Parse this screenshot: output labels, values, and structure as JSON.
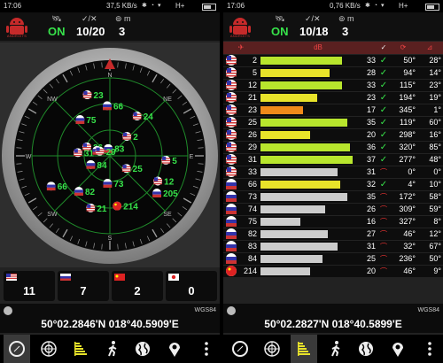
{
  "left": {
    "status": {
      "time": "17:06",
      "speed": "37,5 KB/s",
      "carrier": "H+"
    },
    "header": {
      "logo_text": "ANDROITS",
      "fix": "ON",
      "sats": "10/20",
      "m_value": "3"
    },
    "radar": {
      "compass_labels": [
        "N",
        "NE",
        "E",
        "SE",
        "S",
        "SW",
        "W",
        "NW"
      ],
      "satellites": [
        {
          "prn": "23",
          "flag": "us",
          "az": 345,
          "el": 17
        },
        {
          "prn": "66",
          "flag": "ru",
          "az": 4,
          "el": 32
        },
        {
          "prn": "24",
          "flag": "us",
          "az": 40,
          "el": 30
        },
        {
          "prn": "2",
          "flag": "us",
          "az": 50,
          "el": 55
        },
        {
          "prn": "75",
          "flag": "ru",
          "az": 327,
          "el": 40
        },
        {
          "prn": "26",
          "flag": "us",
          "az": 298,
          "el": 68
        },
        {
          "prn": "74",
          "flag": "ru",
          "az": 309,
          "el": 80
        },
        {
          "prn": "83",
          "flag": "ru",
          "az": 32,
          "el": 80
        },
        {
          "prn": "29",
          "flag": "us",
          "az": 320,
          "el": 83
        },
        {
          "prn": "31",
          "flag": "us",
          "az": 277,
          "el": 60
        },
        {
          "prn": "25",
          "flag": "us",
          "az": 119,
          "el": 60
        },
        {
          "prn": "5",
          "flag": "us",
          "az": 94,
          "el": 18
        },
        {
          "prn": "12",
          "flag": "us",
          "az": 115,
          "el": 21
        },
        {
          "prn": "205",
          "flag": "ru",
          "az": 125,
          "el": 15
        },
        {
          "prn": "84",
          "flag": "ru",
          "az": 236,
          "el": 72
        },
        {
          "prn": "73",
          "flag": "ru",
          "az": 172,
          "el": 58
        },
        {
          "prn": "82",
          "flag": "ru",
          "az": 215,
          "el": 40
        },
        {
          "prn": "66",
          "flag": "ru",
          "az": 240,
          "el": 20
        },
        {
          "prn": "21",
          "flag": "us",
          "az": 194,
          "el": 28
        },
        {
          "prn": "214",
          "flag": "cn",
          "az": 165,
          "el": 30
        }
      ]
    },
    "counts": [
      {
        "flag": "us",
        "value": "11"
      },
      {
        "flag": "ru",
        "value": "7"
      },
      {
        "flag": "cn",
        "value": "2"
      },
      {
        "flag": "jp",
        "value": "0"
      }
    ],
    "coords": {
      "datum": "WGS84",
      "text": "50°02.2846'N   018°40.5909'E"
    }
  },
  "right": {
    "status": {
      "time": "17:06",
      "speed": "0,76 KB/s",
      "carrier": "H+"
    },
    "header": {
      "logo_text": "ANDROITS",
      "fix": "ON",
      "sats": "10/18",
      "m_value": "3"
    },
    "table": {
      "header_label": "dB",
      "max_snr": 40,
      "rows": [
        {
          "flag": "us",
          "prn": "2",
          "snr": "33",
          "used": true,
          "az": "50°",
          "el": "28°",
          "color": "#b8e62d"
        },
        {
          "flag": "us",
          "prn": "5",
          "snr": "28",
          "used": true,
          "az": "94°",
          "el": "14°",
          "color": "#e8e32a"
        },
        {
          "flag": "us",
          "prn": "12",
          "snr": "33",
          "used": true,
          "az": "115°",
          "el": "23°",
          "color": "#b8e62d"
        },
        {
          "flag": "us",
          "prn": "21",
          "snr": "23",
          "used": true,
          "az": "194°",
          "el": "19°",
          "color": "#e8e32a"
        },
        {
          "flag": "us",
          "prn": "23",
          "snr": "17",
          "used": true,
          "az": "345°",
          "el": "1°",
          "color": "#f08a1a"
        },
        {
          "flag": "us",
          "prn": "25",
          "snr": "35",
          "used": true,
          "az": "119°",
          "el": "60°",
          "color": "#b8e62d"
        },
        {
          "flag": "us",
          "prn": "26",
          "snr": "20",
          "used": true,
          "az": "298°",
          "el": "16°",
          "color": "#e8e32a"
        },
        {
          "flag": "us",
          "prn": "29",
          "snr": "36",
          "used": true,
          "az": "320°",
          "el": "85°",
          "color": "#b8e62d"
        },
        {
          "flag": "us",
          "prn": "31",
          "snr": "37",
          "used": true,
          "az": "277°",
          "el": "48°",
          "color": "#b8e62d"
        },
        {
          "flag": "us",
          "prn": "33",
          "snr": "31",
          "used": false,
          "az": "0°",
          "el": "0°",
          "color": "#cccccc"
        },
        {
          "flag": "ru",
          "prn": "66",
          "snr": "32",
          "used": true,
          "az": "4°",
          "el": "10°",
          "color": "#e8e32a"
        },
        {
          "flag": "ru",
          "prn": "73",
          "snr": "35",
          "used": false,
          "az": "172°",
          "el": "58°",
          "color": "#cccccc"
        },
        {
          "flag": "ru",
          "prn": "74",
          "snr": "26",
          "used": false,
          "az": "309°",
          "el": "59°",
          "color": "#cccccc"
        },
        {
          "flag": "ru",
          "prn": "75",
          "snr": "16",
          "used": false,
          "az": "327°",
          "el": "8°",
          "color": "#cccccc"
        },
        {
          "flag": "ru",
          "prn": "82",
          "snr": "27",
          "used": false,
          "az": "46°",
          "el": "12°",
          "color": "#cccccc"
        },
        {
          "flag": "ru",
          "prn": "83",
          "snr": "31",
          "used": false,
          "az": "32°",
          "el": "67°",
          "color": "#cccccc"
        },
        {
          "flag": "ru",
          "prn": "84",
          "snr": "25",
          "used": false,
          "az": "236°",
          "el": "50°",
          "color": "#cccccc"
        },
        {
          "flag": "cn",
          "prn": "214",
          "snr": "20",
          "used": false,
          "az": "46°",
          "el": "9°",
          "color": "#cccccc"
        }
      ]
    },
    "coords": {
      "datum": "WGS84",
      "text": "50°02.2827'N   018°40.5899'E"
    }
  },
  "nav": {
    "items": [
      "compass-icon",
      "radar-icon",
      "signal-bars-icon",
      "walk-icon",
      "globe-icon",
      "map-pin-icon",
      "more-icon"
    ],
    "left_active": 0,
    "right_active": 2
  },
  "colors": {
    "accent_green": "#37e24a",
    "radar_green": "#1f8a2a",
    "red": "#e33333"
  }
}
